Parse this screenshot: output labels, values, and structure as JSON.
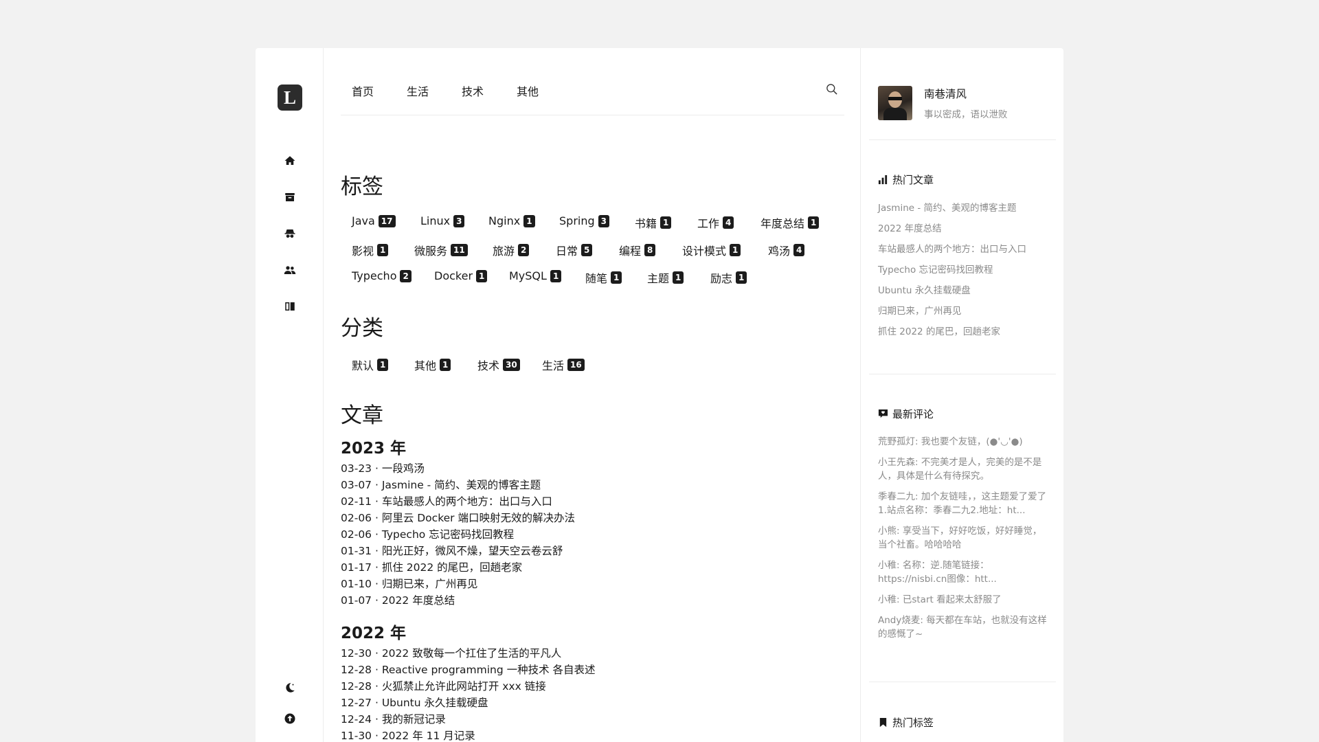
{
  "logo": {
    "letter": "L"
  },
  "rail": {
    "icons": [
      "home-icon",
      "archive-icon",
      "spy-icon",
      "users-icon",
      "book-icon",
      "moon-icon",
      "arrow-up-icon"
    ]
  },
  "nav": {
    "items": [
      "首页",
      "生活",
      "技术",
      "其他"
    ],
    "search_icon": "search-icon"
  },
  "tags": {
    "title": "标签",
    "rows": [
      [
        {
          "name": "Java",
          "count": "17"
        },
        {
          "name": "Linux",
          "count": "3"
        },
        {
          "name": "Nginx",
          "count": "1"
        },
        {
          "name": "Spring",
          "count": "3"
        },
        {
          "name": "书籍",
          "count": "1"
        },
        {
          "name": "工作",
          "count": "4"
        },
        {
          "name": "年度总结",
          "count": "1"
        }
      ],
      [
        {
          "name": "影视",
          "count": "1"
        },
        {
          "name": "微服务",
          "count": "11"
        },
        {
          "name": "旅游",
          "count": "2"
        },
        {
          "name": "日常",
          "count": "5"
        },
        {
          "name": "编程",
          "count": "8"
        },
        {
          "name": "设计模式",
          "count": "1"
        },
        {
          "name": "鸡汤",
          "count": "4"
        }
      ],
      [
        {
          "name": "Typecho",
          "count": "2"
        },
        {
          "name": "Docker",
          "count": "1"
        },
        {
          "name": "MySQL",
          "count": "1"
        },
        {
          "name": "随笔",
          "count": "1"
        },
        {
          "name": "主题",
          "count": "1"
        },
        {
          "name": "励志",
          "count": "1"
        }
      ]
    ]
  },
  "categories": {
    "title": "分类",
    "items": [
      {
        "name": "默认",
        "count": "1"
      },
      {
        "name": "其他",
        "count": "1"
      },
      {
        "name": "技术",
        "count": "30"
      },
      {
        "name": "生活",
        "count": "16"
      }
    ]
  },
  "archive": {
    "title": "文章",
    "years": [
      {
        "year": "2023 年",
        "posts": [
          "03-23 · 一段鸡汤",
          "03-07 · Jasmine - 简约、美观的博客主题",
          "02-11 · 车站最感人的两个地方：出口与入口",
          "02-06 · 阿里云 Docker 端口映射无效的解决办法",
          "02-06 · Typecho 忘记密码找回教程",
          "01-31 · 阳光正好，微风不燥，望天空云卷云舒",
          "01-17 · 抓住 2022 的尾巴，回趟老家",
          "01-10 · 归期已来，广州再见",
          "01-07 · 2022 年度总结"
        ]
      },
      {
        "year": "2022 年",
        "posts": [
          "12-30 · 2022 致敬每一个扛住了生活的平凡人",
          "12-28 · Reactive programming 一种技术 各自表述",
          "12-28 · 火狐禁止允许此网站打开 xxx 链接",
          "12-27 · Ubuntu 永久挂载硬盘",
          "12-24 · 我的新冠记录",
          "11-30 · 2022 年 11 月记录"
        ]
      }
    ]
  },
  "profile": {
    "name": "南巷清风",
    "motto": "事以密成，语以泄败"
  },
  "hot_posts": {
    "title": "热门文章",
    "items": [
      "Jasmine - 简约、美观的博客主题",
      "2022 年度总结",
      "车站最感人的两个地方：出口与入口",
      "Typecho 忘记密码找回教程",
      "Ubuntu 永久挂载硬盘",
      "归期已来，广州再见",
      "抓住 2022 的尾巴，回趟老家"
    ]
  },
  "latest_comments": {
    "title": "最新评论",
    "items": [
      "荒野孤灯: 我也要个友链，(●'◡'●)",
      "小王先森: 不完美才是人，完美的是不是人，具体是什么有待探究。",
      "季春二九: 加个友链哇，，这主题爱了爱了1.站点名称：季春二九2.地址：ht...",
      "小熊: 享受当下，好好吃饭，好好睡觉，当个社畜。哈哈哈哈",
      "小稚: 名称：逆.随笔链接：https://nisbi.cn图像：htt...",
      "小稚: 已start 看起来太舒服了",
      "Andy烧麦: 每天都在车站，也就没有这样的感慨了~"
    ]
  },
  "hot_tags": {
    "title": "热门标签"
  }
}
